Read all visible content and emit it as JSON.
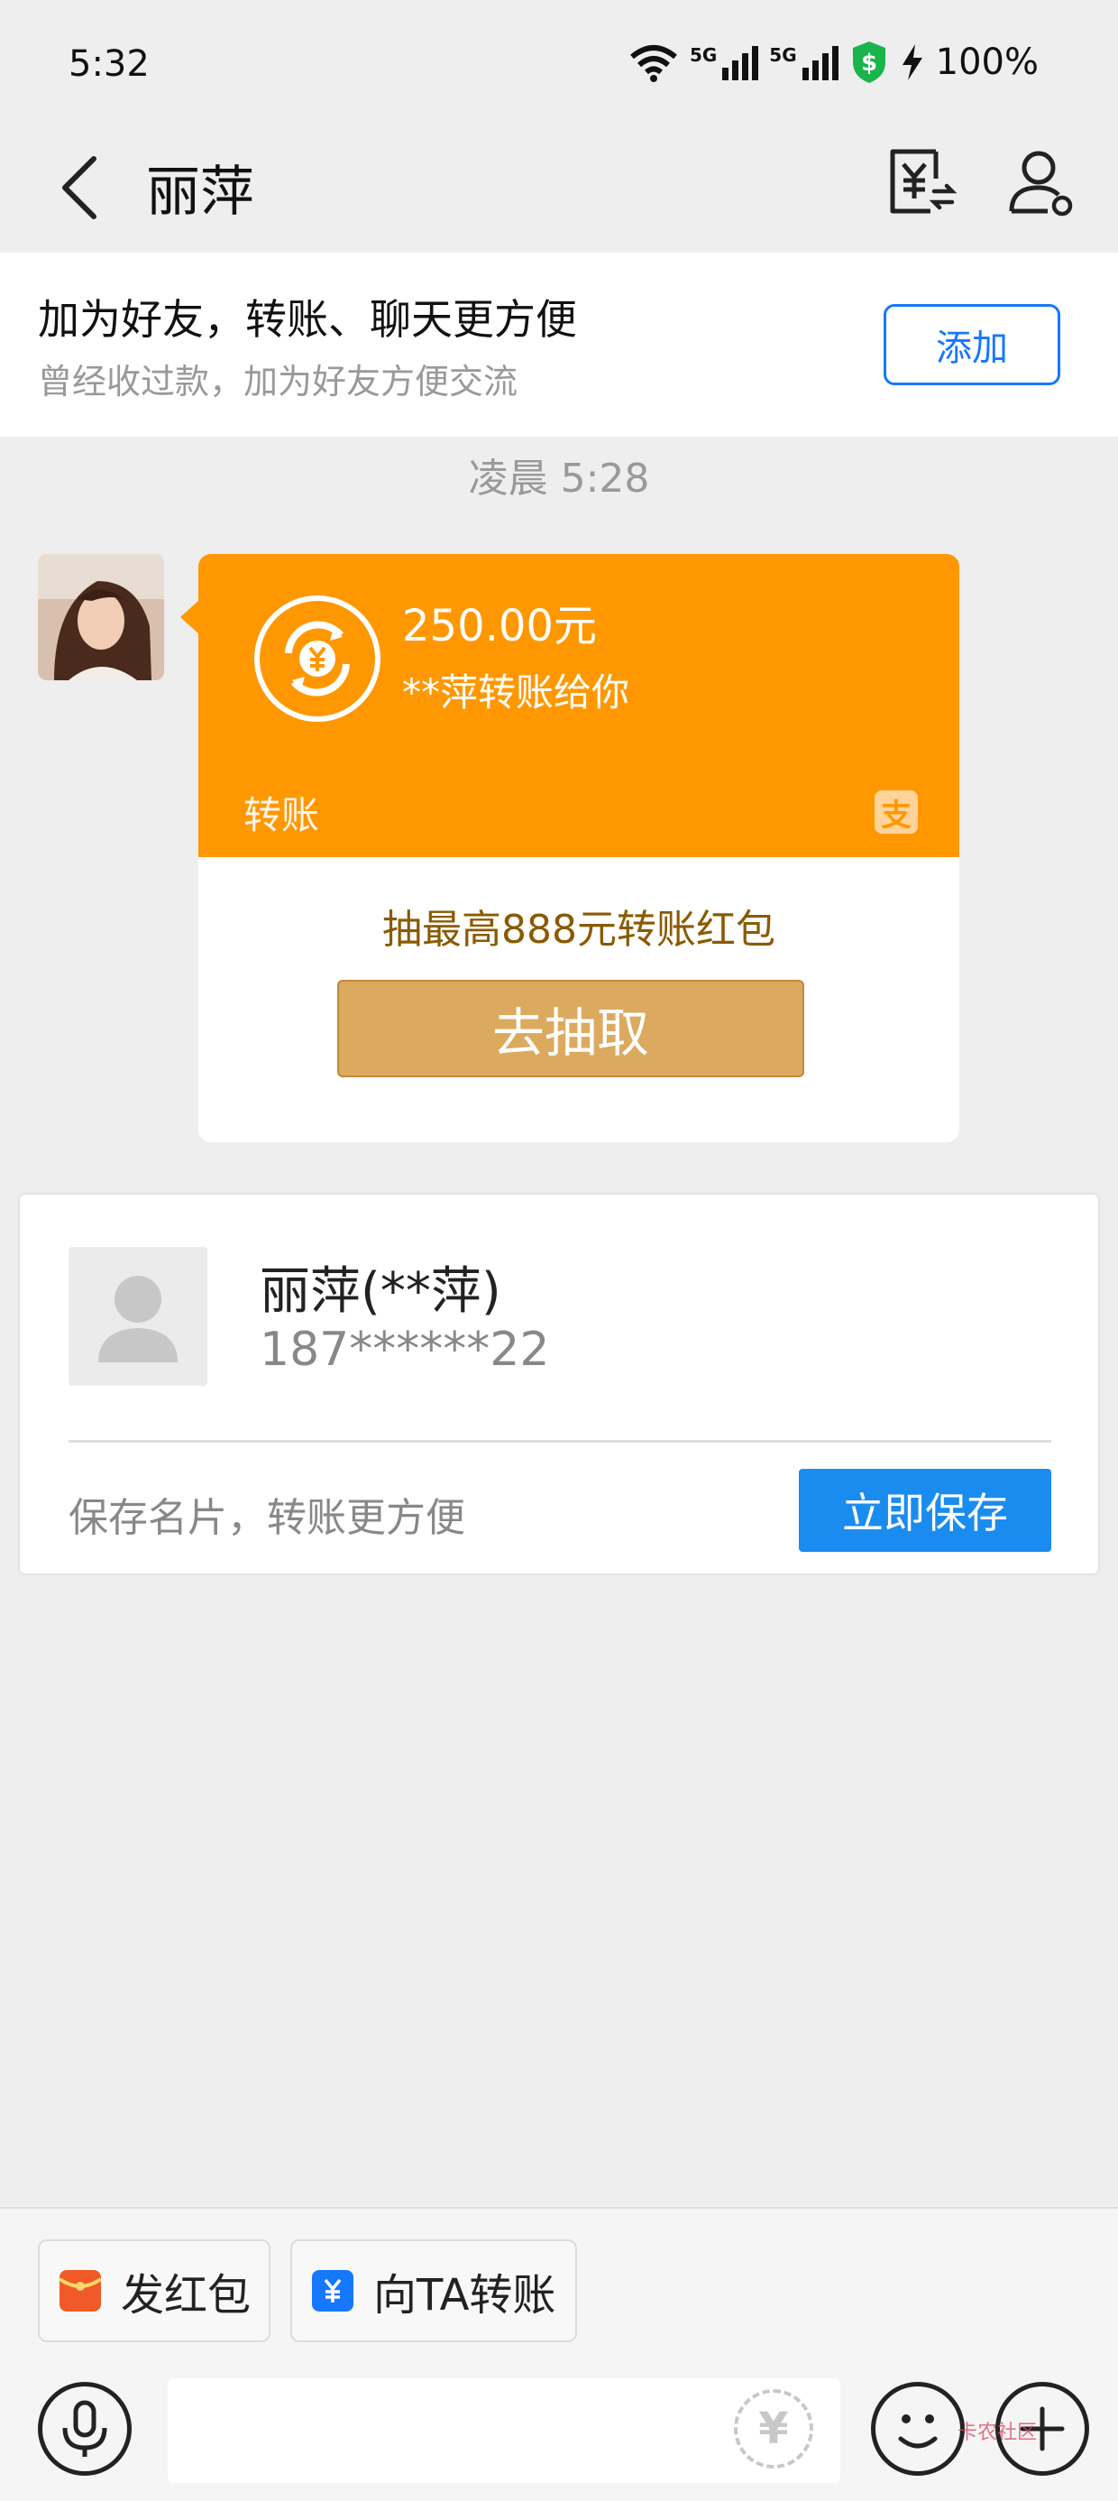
{
  "status_bar": {
    "time": "5:32",
    "network1": "5G",
    "network2": "5G",
    "battery": "100%"
  },
  "header": {
    "title": "丽萍"
  },
  "friend_banner": {
    "heading": "加为好友，转账、聊天更方便",
    "subtext": "曾经收过款，加为好友方便交流",
    "add_label": "添加"
  },
  "chat": {
    "timestamp": "凌晨 5:28",
    "transfer": {
      "amount": "250.00元",
      "from": "**萍转账给你",
      "label": "转账",
      "promo": "抽最高888元转账红包",
      "draw_label": "去抽取"
    }
  },
  "contact_card": {
    "name": "丽萍(**萍)",
    "phone": "187******22",
    "hint": "保存名片，转账更方便",
    "save_label": "立即保存"
  },
  "bottom": {
    "red_packet_label": "发红包",
    "transfer_label": "向TA转账",
    "watermark": "卡农社区"
  },
  "colors": {
    "accent_blue": "#1677ff",
    "transfer_orange": "#ff9800",
    "draw_gold": "#dcaa5e",
    "save_blue": "#1a8cf0",
    "red_packet": "#f05a28"
  },
  "icons": [
    "wifi-icon",
    "signal-icon",
    "shield-dollar-icon",
    "charging-icon",
    "back-arrow-icon",
    "transfer-yen-icon",
    "profile-icon",
    "transfer-coin-icon",
    "alipay-logo-icon",
    "default-avatar-icon",
    "red-packet-icon",
    "transfer-icon",
    "voice-icon",
    "yen-icon",
    "emoji-icon",
    "plus-icon"
  ]
}
